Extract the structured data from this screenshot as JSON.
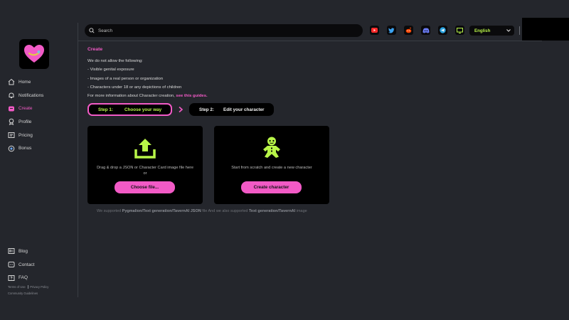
{
  "search": {
    "placeholder": "Search"
  },
  "language": {
    "selected": "English"
  },
  "social": [
    "youtube-icon",
    "twitter-icon",
    "reddit-icon",
    "discord-icon",
    "telegram-icon",
    "screen-icon"
  ],
  "sidebar": {
    "items": [
      {
        "label": "Home",
        "icon": "home-icon"
      },
      {
        "label": "Notifications",
        "icon": "bell-icon"
      },
      {
        "label": "Create",
        "icon": "create-icon",
        "active": true
      },
      {
        "label": "Profile",
        "icon": "profile-icon"
      },
      {
        "label": "Pricing",
        "icon": "pricing-icon"
      },
      {
        "label": "Bonus",
        "icon": "bonus-icon"
      }
    ],
    "bottom": [
      {
        "label": "Blog",
        "icon": "blog-icon"
      },
      {
        "label": "Contact",
        "icon": "contact-icon"
      },
      {
        "label": "FAQ",
        "icon": "faq-icon"
      }
    ],
    "footer": {
      "terms": "Terms of Use",
      "privacy": "Privacy Policy",
      "guidelines": "Community Guidelines"
    }
  },
  "main": {
    "title": "Create",
    "rules_intro": "We do not allow the following:",
    "rules": [
      "- Visible genital exposure",
      "- Images of a real person or organization",
      "- Characters under 18 or any depictions of children"
    ],
    "more_info": "For more information about Character creation, ",
    "guides_link": "see this guides.",
    "steps": [
      {
        "number": "Step 1:",
        "label": "Choose your way"
      },
      {
        "number": "Step 2:",
        "label": "Edit your character"
      }
    ],
    "upload_card": {
      "text": "Drag & drop a JSON or Character Card image file here",
      "or": "or",
      "button": "Choose file..."
    },
    "scratch_card": {
      "text": "Start from scratch and create a new character",
      "button": "Create character"
    },
    "note": {
      "prefix": "We supported ",
      "json_format": "Pygmalion/Text generation/TavernAI JSON",
      "middle": " file And we also supported ",
      "image_format": "Text generation/TavernAI",
      "suffix": " image"
    }
  },
  "colors": {
    "accent": "#f25ac6",
    "lime": "#b8f548",
    "background": "#24262c"
  }
}
